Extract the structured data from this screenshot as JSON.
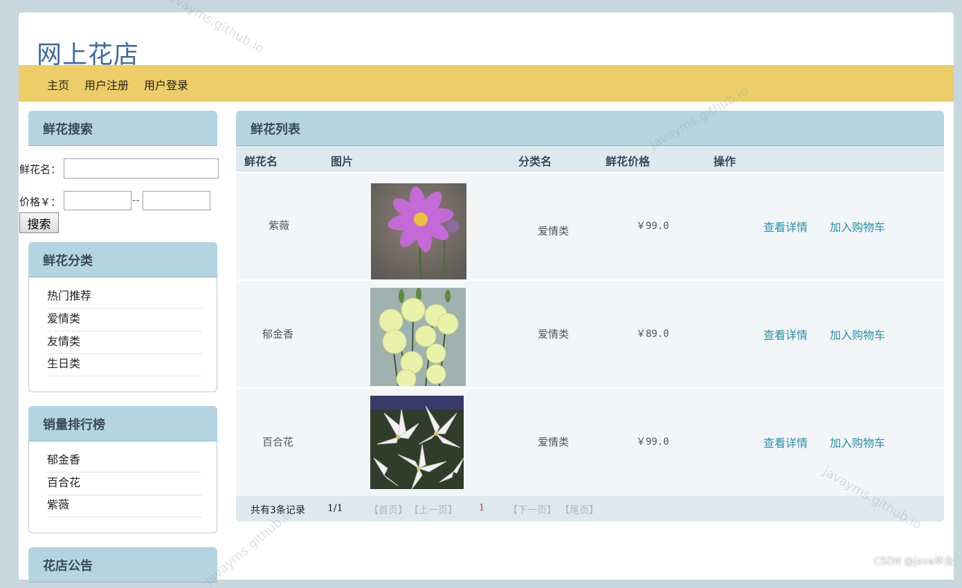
{
  "site": {
    "title": "网上花店"
  },
  "nav": [
    "主页",
    "用户注册",
    "用户登录"
  ],
  "search": {
    "title": "鲜花搜索",
    "name_label": "鲜花名：",
    "name_value": "",
    "price_label": "价格￥：",
    "price_min": "",
    "price_sep": "--",
    "price_max": "",
    "button": "搜索"
  },
  "categories": {
    "title": "鲜花分类",
    "items": [
      "热门推荐",
      "爱情类",
      "友情类",
      "生日类"
    ]
  },
  "ranking": {
    "title": "销量排行榜",
    "items": [
      "郁金香",
      "百合花",
      "紫薇"
    ]
  },
  "notice": {
    "title": "花店公告"
  },
  "list": {
    "title": "鲜花列表",
    "columns": [
      "鲜花名",
      "图片",
      "分类名",
      "鲜花价格",
      "操作"
    ],
    "rows": [
      {
        "name": "紫薇",
        "image": "pink-cosmos-flower-photo",
        "category": "爱情类",
        "price": "￥99.0",
        "detail": "查看详情",
        "cart": "加入购物车"
      },
      {
        "name": "郁金香",
        "image": "pale-yellow-lisianthus-photo",
        "category": "爱情类",
        "price": "￥89.0",
        "detail": "查看详情",
        "cart": "加入购物车"
      },
      {
        "name": "百合花",
        "image": "white-lily-photo",
        "category": "爱情类",
        "price": "￥99.0",
        "detail": "查看详情",
        "cart": "加入购物车"
      }
    ]
  },
  "pager": {
    "total": "共有3条记录",
    "page": "1/1",
    "first": "【首页】",
    "prev": "【上一页】",
    "current": "1",
    "next": "【下一页】",
    "last": "【尾页】"
  },
  "watermark": "javayms.github.io",
  "credit": "CSDN @java毕业",
  "colors": {
    "nav_bg": "#eccd67",
    "panel_head": "#b4d4e1",
    "link": "#2a8fa6",
    "title": "#3f6aa0"
  }
}
